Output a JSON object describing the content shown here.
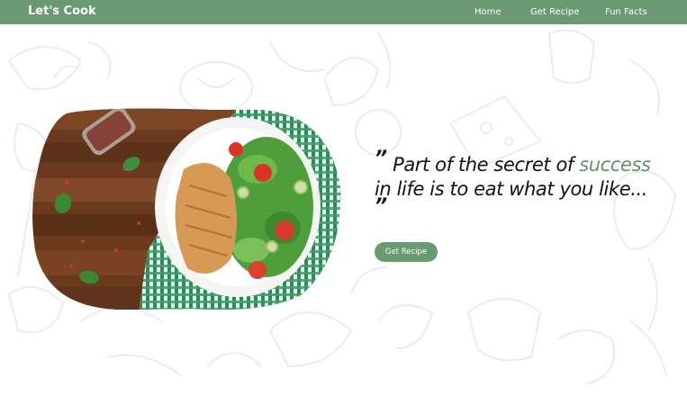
{
  "colors": {
    "nav_bg": "#6a9a72",
    "accent": "#5c9468",
    "button_bg": "#6a9a72",
    "text_dark": "#111111",
    "nav_text": "#ffffff",
    "doodle_stroke": "#ececec"
  },
  "navbar": {
    "brand": "Let's Cook",
    "links": [
      {
        "label": "Home"
      },
      {
        "label": "Get Recipe"
      },
      {
        "label": "Fun Facts"
      }
    ]
  },
  "hero": {
    "image_icon": "grilled-chicken-salad-plate",
    "quote_open": "”",
    "quote_part1": "Part of the secret of",
    "quote_accent": "success",
    "quote_part2": "in life is to eat what you like...",
    "quote_close": "”",
    "button_label": "Get Recipe"
  },
  "background_icon": "food-doodle-pattern"
}
